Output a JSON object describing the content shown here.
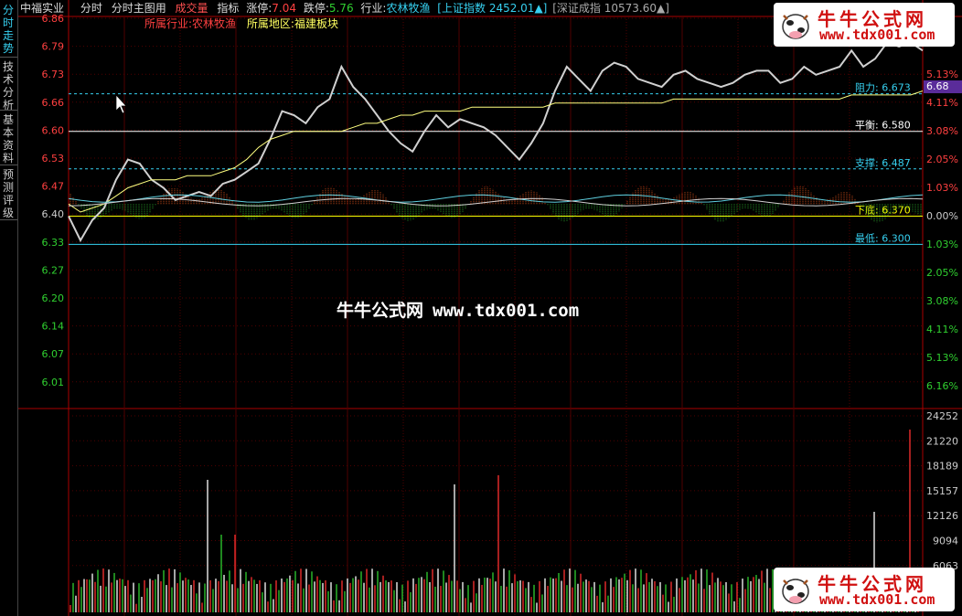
{
  "sidebar": {
    "tabs": [
      {
        "label": "分时走势",
        "active": true
      },
      {
        "label": "技术分析",
        "active": false
      },
      {
        "label": "基本资料",
        "active": false
      },
      {
        "label": "预测评级",
        "active": false
      }
    ]
  },
  "header": {
    "stock_name": "中福实业",
    "mode": "分时",
    "main_chart_label": "分时主图用",
    "volume_label": "成交量",
    "indicator_label": "指标",
    "limit_up_label": "涨停:",
    "limit_up_value": "7.04",
    "limit_down_label": "跌停:",
    "limit_down_value": "5.76",
    "industry_label": "行业:",
    "industry_value": "农林牧渔",
    "sh_index_label": "[上证指数",
    "sh_index_value": "2452.01",
    "sh_index_arrow": "▲]",
    "sz_index_label": "[深证成指",
    "sz_index_value": "10573.60",
    "sz_index_arrow": "▲]"
  },
  "subheader": {
    "industry_label": "所属行业",
    "industry_value": ":农林牧渔",
    "region_label": "所属地区",
    "region_value": ":福建板块"
  },
  "price_axis": [
    "6.86",
    "6.79",
    "6.73",
    "6.66",
    "6.60",
    "6.53",
    "6.47",
    "6.40",
    "6.33",
    "6.27",
    "6.20",
    "6.14",
    "6.07",
    "6.01"
  ],
  "pct_axis": [
    "5.13%",
    "4.11%",
    "3.08%",
    "2.05%",
    "1.03%",
    "0.00%",
    "1.03%",
    "2.05%",
    "3.08%",
    "4.11%",
    "5.13%",
    "6.16%"
  ],
  "volume_axis": [
    "24252",
    "21220",
    "18189",
    "15157",
    "12126",
    "9094",
    "6063"
  ],
  "current_price_tag": "6.68",
  "levels": [
    {
      "label": "阻力:",
      "value": "6.673",
      "price": 6.673,
      "color": "#36d0f0"
    },
    {
      "label": "平衡:",
      "value": "6.580",
      "price": 6.58,
      "color": "#ffffff"
    },
    {
      "label": "支撑:",
      "value": "6.487",
      "price": 6.487,
      "color": "#36d0f0"
    },
    {
      "label": "下底:",
      "value": "6.370",
      "price": 6.37,
      "color": "#ffff00"
    },
    {
      "label": "最低:",
      "value": "6.300",
      "price": 6.3,
      "color": "#36d0f0"
    }
  ],
  "watermark": {
    "cn": "牛牛公式网",
    "url": "www.tdx001.com"
  },
  "logo": {
    "cn": "牛牛公式网",
    "url": "www.tdx001.com"
  },
  "colors": {
    "up": "#ff3030",
    "down": "#30d030",
    "axis": "#aa0000",
    "price_line": "#d0d0d0",
    "avg_line": "#ffff80",
    "accent": "#36d0f0"
  },
  "chart_data": {
    "type": "line",
    "prev_close": 6.4,
    "price_series": [
      6.37,
      6.31,
      6.36,
      6.39,
      6.46,
      6.51,
      6.5,
      6.46,
      6.44,
      6.41,
      6.42,
      6.43,
      6.42,
      6.45,
      6.46,
      6.48,
      6.5,
      6.56,
      6.63,
      6.62,
      6.6,
      6.64,
      6.66,
      6.74,
      6.69,
      6.66,
      6.62,
      6.58,
      6.55,
      6.53,
      6.58,
      6.62,
      6.59,
      6.61,
      6.6,
      6.59,
      6.57,
      6.54,
      6.51,
      6.55,
      6.6,
      6.68,
      6.74,
      6.71,
      6.68,
      6.73,
      6.75,
      6.74,
      6.71,
      6.7,
      6.69,
      6.72,
      6.73,
      6.71,
      6.7,
      6.69,
      6.7,
      6.72,
      6.73,
      6.73,
      6.7,
      6.71,
      6.74,
      6.72,
      6.73,
      6.74,
      6.78,
      6.74,
      6.76,
      6.8,
      6.79,
      6.8,
      6.78
    ],
    "avg_series": [
      6.4,
      6.38,
      6.39,
      6.4,
      6.42,
      6.44,
      6.45,
      6.46,
      6.46,
      6.46,
      6.47,
      6.47,
      6.47,
      6.48,
      6.49,
      6.51,
      6.54,
      6.56,
      6.57,
      6.58,
      6.58,
      6.58,
      6.58,
      6.58,
      6.59,
      6.6,
      6.6,
      6.61,
      6.62,
      6.62,
      6.63,
      6.63,
      6.63,
      6.63,
      6.64,
      6.64,
      6.64,
      6.64,
      6.64,
      6.64,
      6.64,
      6.65,
      6.65,
      6.65,
      6.65,
      6.65,
      6.65,
      6.65,
      6.65,
      6.65,
      6.65,
      6.66,
      6.66,
      6.66,
      6.66,
      6.66,
      6.66,
      6.66,
      6.66,
      6.66,
      6.66,
      6.66,
      6.66,
      6.66,
      6.66,
      6.66,
      6.67,
      6.67,
      6.67,
      6.67,
      6.67,
      6.67,
      6.68
    ],
    "ylim": [
      5.95,
      6.86
    ],
    "volume_max": 24252
  }
}
